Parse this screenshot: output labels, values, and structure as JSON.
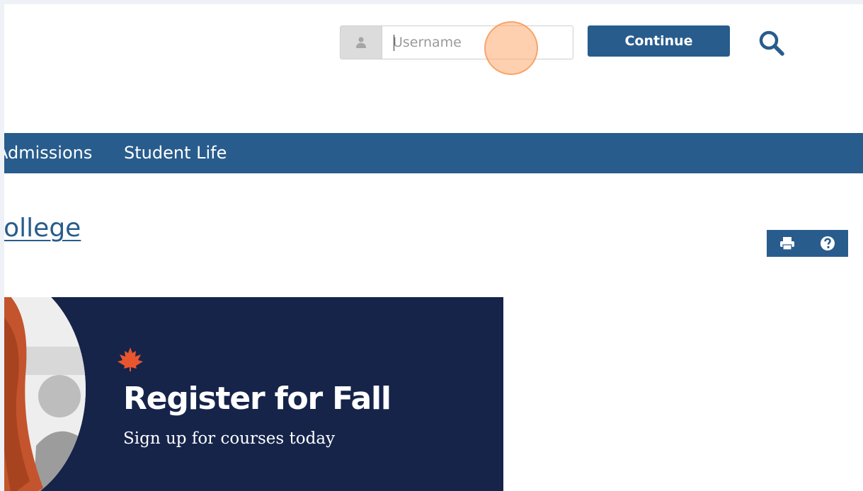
{
  "login": {
    "username_placeholder": "Username",
    "continue_label": "Continue"
  },
  "nav": {
    "items": [
      {
        "label": "Admissions"
      },
      {
        "label": "Student Life"
      }
    ]
  },
  "page": {
    "title": "College"
  },
  "banner": {
    "headline": "Register for Fall",
    "subtext": "Sign up for courses today"
  },
  "colors": {
    "brand_blue": "#285c8c",
    "banner_navy": "#16244a",
    "leaf_orange": "#e8552e"
  },
  "icons": {
    "user": "user-icon",
    "search": "search-icon",
    "print": "print-icon",
    "help": "help-icon",
    "leaf": "maple-leaf-icon"
  }
}
